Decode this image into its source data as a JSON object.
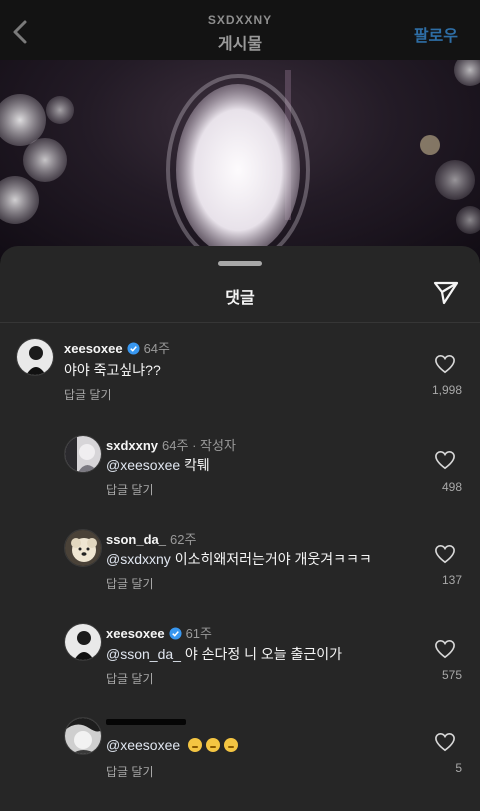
{
  "header": {
    "username": "SXDXXNY",
    "title": "게시물",
    "follow_label": "팔로우"
  },
  "sheet": {
    "title": "댓글"
  },
  "comments": [
    {
      "username": "xeesoxee",
      "verified": true,
      "time": "64주",
      "author_tag": "",
      "mention": "",
      "text": "야야 죽고싶냐??",
      "reply_label": "답글 달기",
      "likes": "1,998"
    },
    {
      "username": "sxdxxny",
      "verified": false,
      "time": "64주",
      "author_tag": "· 작성자",
      "mention": "@xeesoxee",
      "text": "칵퉤",
      "reply_label": "답글 달기",
      "likes": "498"
    },
    {
      "username": "sson_da_",
      "verified": false,
      "time": "62주",
      "author_tag": "",
      "mention": "@sxdxxny",
      "text": "이소히왜저러는거야 개웃겨ㅋㅋㅋ",
      "reply_label": "답글 달기",
      "likes": "137"
    },
    {
      "username": "xeesoxee",
      "verified": true,
      "time": "61주",
      "author_tag": "",
      "mention": "@sson_da_",
      "text": "야 손다정 니 오늘 출근이가",
      "reply_label": "답글 달기",
      "likes": "575"
    },
    {
      "username": "",
      "verified": false,
      "time": "",
      "author_tag": "",
      "mention": "@xeesoxee",
      "text": "",
      "emojis": [
        "crying-face",
        "crying-face",
        "crying-face"
      ],
      "reply_label": "답글 달기",
      "likes": "5"
    }
  ],
  "icons": {
    "back": "chevron-left-icon",
    "share": "paper-plane-icon",
    "like": "heart-outline-icon",
    "verified": "verified-badge-icon"
  },
  "colors": {
    "follow": "#2e6ea6",
    "verified": "#3897f0",
    "sheet_bg": "#262626"
  }
}
